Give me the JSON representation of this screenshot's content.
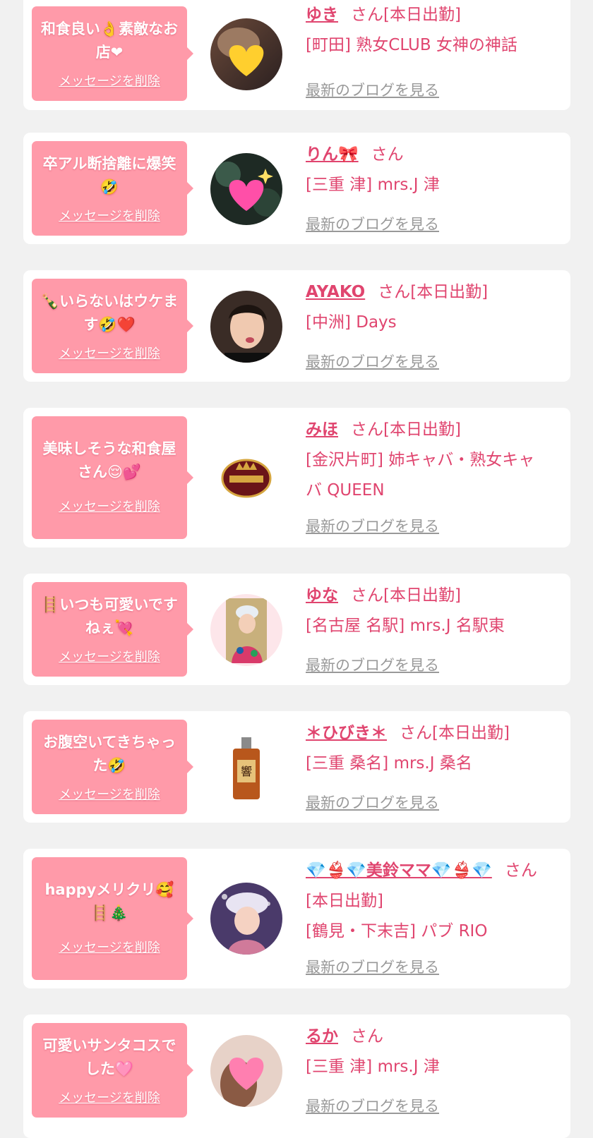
{
  "accent_color": "#e0456f",
  "bubble_color": "#ff9aa9",
  "delete_label": "メッセージを削除",
  "blog_label": "最新のブログを見る",
  "messages": [
    {
      "message": "和食良い👌素敵なお店❤",
      "name": "ゆき",
      "suffix": "さん[本日出勤]",
      "shop": "[町田] 熟女CLUB 女神の神話",
      "avatar": "yellow-heart-emoji-photo"
    },
    {
      "message": "卒アル断捨離に爆笑🤣",
      "name": "りん🎀",
      "suffix": "さん",
      "shop": "[三重 津] mrs.J 津",
      "avatar": "sparkling-heart-emoji-photo"
    },
    {
      "message": "🍾いらないはウケます🤣❤️",
      "name": "AYAKO",
      "suffix": "さん[本日出勤]",
      "shop": "[中洲] Days",
      "avatar": "woman-portrait-photo"
    },
    {
      "message": "美味しそうな和食屋さん😌💕",
      "name": "みほ",
      "suffix": "さん[本日出勤]",
      "shop": "[金沢片町] 姉キャバ・熟女キャバ QUEEN",
      "avatar": "queen-logo"
    },
    {
      "message": "🪜いつも可愛いですねぇ💘",
      "name": "ゆな",
      "suffix": "さん[本日出勤]",
      "shop": "[名古屋 名駅] mrs.J 名駅東",
      "avatar": "woman-cap-photo"
    },
    {
      "message": "お腹空いてきちゃった🤣",
      "name": "＊ひびき＊",
      "suffix": "さん[本日出勤]",
      "shop": "[三重 桑名] mrs.J 桑名",
      "avatar": "whisky-bottle-photo"
    },
    {
      "message": "happyメリクリ🥰🪜🎄",
      "name": "💎👙💎美鈴ママ💎👙💎",
      "suffix": "さん[本日出勤]",
      "shop": "[鶴見・下末吉] パブ RIO",
      "avatar": "woman-santa-hat-photo"
    },
    {
      "message": "可愛いサンタコスでした🩷",
      "name": "るか",
      "suffix": "さん",
      "shop": "[三重 津] mrs.J 津",
      "avatar": "pink-heart-emoji-photo"
    }
  ]
}
